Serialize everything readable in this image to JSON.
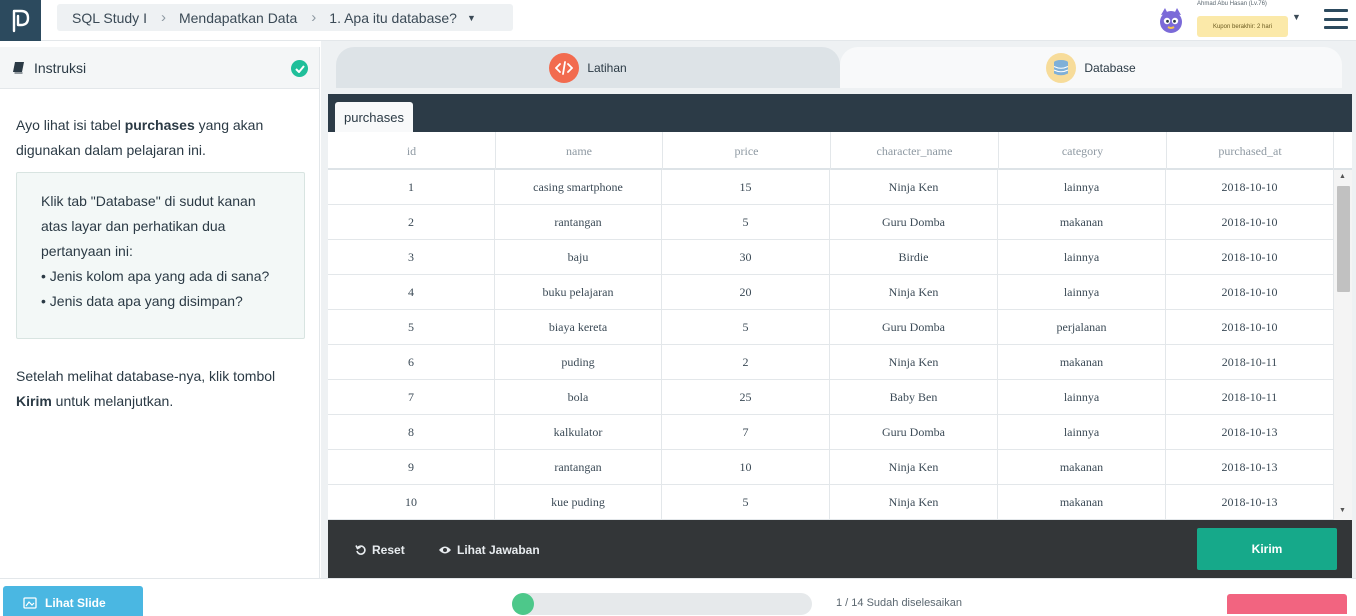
{
  "colors": {
    "brand": "#2c4a5e",
    "accent_green": "#16a98a",
    "check": "#1fbf9a",
    "progress": "#4dc88a",
    "slide_button": "#4ab7e2"
  },
  "breadcrumb": {
    "items": [
      "SQL Study I",
      "Mendapatkan Data",
      "1. Apa itu database?"
    ]
  },
  "user": {
    "name": "Ahmad Abu Hasan (Lv.76)",
    "coupon": "Kupon berakhir: 2 hari"
  },
  "instructions": {
    "header": "Instruksi",
    "intro_pre": "Ayo lihat isi tabel ",
    "intro_bold": "purchases",
    "intro_post": " yang akan digunakan dalam pelajaran ini.",
    "box_lines": [
      "Klik tab \"Database\" di sudut kanan atas layar dan perhatikan dua pertanyaan ini:",
      "• Jenis kolom apa yang ada di sana?",
      "• Jenis data apa yang disimpan?"
    ],
    "bottom_pre": "Setelah melihat database-nya, klik tombol ",
    "bottom_bold": "Kirim",
    "bottom_post": " untuk melanjutkan."
  },
  "tabs": {
    "latihan": "Latihan",
    "database": "Database"
  },
  "table": {
    "name": "purchases",
    "columns": [
      "id",
      "name",
      "price",
      "character_name",
      "category",
      "purchased_at"
    ],
    "rows": [
      [
        "1",
        "casing smartphone",
        "15",
        "Ninja Ken",
        "lainnya",
        "2018-10-10"
      ],
      [
        "2",
        "rantangan",
        "5",
        "Guru Domba",
        "makanan",
        "2018-10-10"
      ],
      [
        "3",
        "baju",
        "30",
        "Birdie",
        "lainnya",
        "2018-10-10"
      ],
      [
        "4",
        "buku pelajaran",
        "20",
        "Ninja Ken",
        "lainnya",
        "2018-10-10"
      ],
      [
        "5",
        "biaya kereta",
        "5",
        "Guru Domba",
        "perjalanan",
        "2018-10-10"
      ],
      [
        "6",
        "puding",
        "2",
        "Ninja Ken",
        "makanan",
        "2018-10-11"
      ],
      [
        "7",
        "bola",
        "25",
        "Baby Ben",
        "lainnya",
        "2018-10-11"
      ],
      [
        "8",
        "kalkulator",
        "7",
        "Guru Domba",
        "lainnya",
        "2018-10-13"
      ],
      [
        "9",
        "rantangan",
        "10",
        "Ninja Ken",
        "makanan",
        "2018-10-13"
      ],
      [
        "10",
        "kue puding",
        "5",
        "Ninja Ken",
        "makanan",
        "2018-10-13"
      ]
    ]
  },
  "actions": {
    "reset": "Reset",
    "answer": "Lihat Jawaban",
    "submit": "Kirim"
  },
  "footer": {
    "slide": "Lihat Slide",
    "progress_text": "1 / 14  Sudah diselesaikan",
    "progress_fraction": 0.07
  }
}
